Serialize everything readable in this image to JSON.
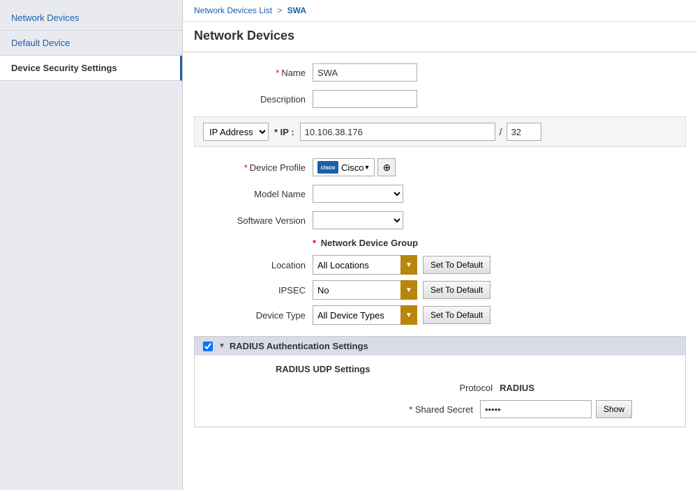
{
  "sidebar": {
    "items": [
      {
        "id": "network-devices",
        "label": "Network Devices",
        "active": false
      },
      {
        "id": "default-device",
        "label": "Default Device",
        "active": false
      },
      {
        "id": "device-security-settings",
        "label": "Device Security Settings",
        "active": true
      }
    ]
  },
  "breadcrumb": {
    "list_link": "Network Devices List",
    "separator": ">",
    "current": "SWA"
  },
  "page_title": "Network Devices",
  "form": {
    "name_label": "Name",
    "name_value": "SWA",
    "name_required": "*",
    "description_label": "Description",
    "description_value": "",
    "ip_type_label": "IP Address",
    "ip_label": "* IP :",
    "ip_value": "10.106.38.176",
    "cidr_value": "32",
    "device_profile_label": "Device Profile",
    "device_profile_required": "*",
    "device_profile_name": "Cisco",
    "model_name_label": "Model Name",
    "software_version_label": "Software Version",
    "ndg_section_label": "Network Device Group",
    "ndg_required": "*",
    "location_label": "Location",
    "location_value": "All Locations",
    "ipsec_label": "IPSEC",
    "ipsec_value": "No",
    "device_type_label": "Device Type",
    "device_type_value": "All Device Types",
    "set_to_default_label": "Set To Default"
  },
  "radius": {
    "section_label": "RADIUS Authentication Settings",
    "udp_title": "RADIUS UDP Settings",
    "protocol_label": "Protocol",
    "protocol_value": "RADIUS",
    "shared_secret_label": "* Shared Secret",
    "shared_secret_placeholder": "•••••",
    "show_button_label": "Show"
  }
}
